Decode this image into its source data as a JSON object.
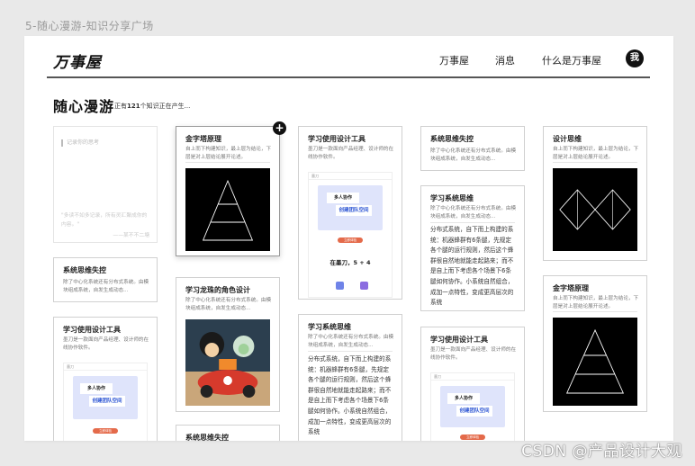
{
  "page_caption": "5-随心漫游-知识分享广场",
  "watermark": "CSDN @产品设计大观",
  "header": {
    "logo": "万事屋",
    "nav": [
      "万事屋",
      "消息",
      "什么是万事屋"
    ],
    "avatar": "我"
  },
  "intro": {
    "title": "随心漫游",
    "subtitle_prefix": "正有",
    "subtitle_count": "121",
    "subtitle_suffix": "个知识正在产生..."
  },
  "add_button": "+",
  "note_card": {
    "placeholder": "记录你的思考",
    "quote": "\"多读不如多记录，所有灵汇聚成你的内容。\"",
    "author": "——某不不二塘"
  },
  "cards": {
    "c_col1_systems": {
      "title": "系统思维失控",
      "desc": "除了中心化系统还有分布式系统。由模块组成系统，自发生成动态..."
    },
    "c_col1_tool": {
      "title": "学习使用设计工具",
      "desc": "墨刀是一款面向产品经理、设计师的在线协作软件。"
    },
    "c_col2_pyramid": {
      "title": "金字塔原理",
      "desc": "自上而下构建知识，最上层为结论，下层是对上层结论展开论述。"
    },
    "c_col2_dragon": {
      "title": "学习龙珠的角色设计",
      "desc": "除了中心化系统还有分布式系统。由模块组成系统，自发生成动态..."
    },
    "c_col2_systems": {
      "title": "系统思维失控",
      "desc": ""
    },
    "c_col3_tool": {
      "title": "学习使用设计工具",
      "desc": "墨刀是一款面向产品经理、设计师的在线协作软件。"
    },
    "c_col3_systhink": {
      "title": "学习系统思维",
      "desc": "除了中心化系统还有分布式系统。由模块组成系统，自发生成动态...",
      "body": "分布式系统，自下而上构建的系统：机器蜂群有6条腿，先规定各个腿的运行规则，然后这个蜂群很自然地就能走起路来；而不是自上而下考虑各个场景下6条腿如何协作。小系统自然组合，成加一点特性，变成更高层次的系统"
    },
    "c_col4_systems": {
      "title": "系统思维失控",
      "desc": "除了中心化系统还有分布式系统。由模块组成系统，自发生成动态..."
    },
    "c_col4_systhink": {
      "title": "学习系统思维",
      "desc": "除了中心化系统还有分布式系统。由模块组成系统，自发生成动态...",
      "body": "分布式系统，自下而上构建的系统：机器蜂群有6条腿，先规定各个腿的运行规则，然后这个蜂群很自然地就能走起路来；而不是自上而下考虑各个场景下6条腿如何协作。小系统自然组合，成加一点特性，变成更高层次的系统"
    },
    "c_col4_tool": {
      "title": "学习使用设计工具",
      "desc": "墨刀是一款面向产品经理、设计师的在线协作软件。"
    },
    "c_col5_design": {
      "title": "设计思维",
      "desc": "自上而下构建知识，最上层为结论，下层是对上层结论展开论述。"
    },
    "c_col5_pyramid": {
      "title": "金字塔原理",
      "desc": "自上而下构建知识，最上层为结论，下层是对上层结论展开论述。"
    }
  },
  "mock_ui": {
    "chip1": "多人协作",
    "chip2": "创建团队空间",
    "button": "立即体验",
    "count": "在墨刀，5 + 4",
    "top": "墨刀"
  }
}
